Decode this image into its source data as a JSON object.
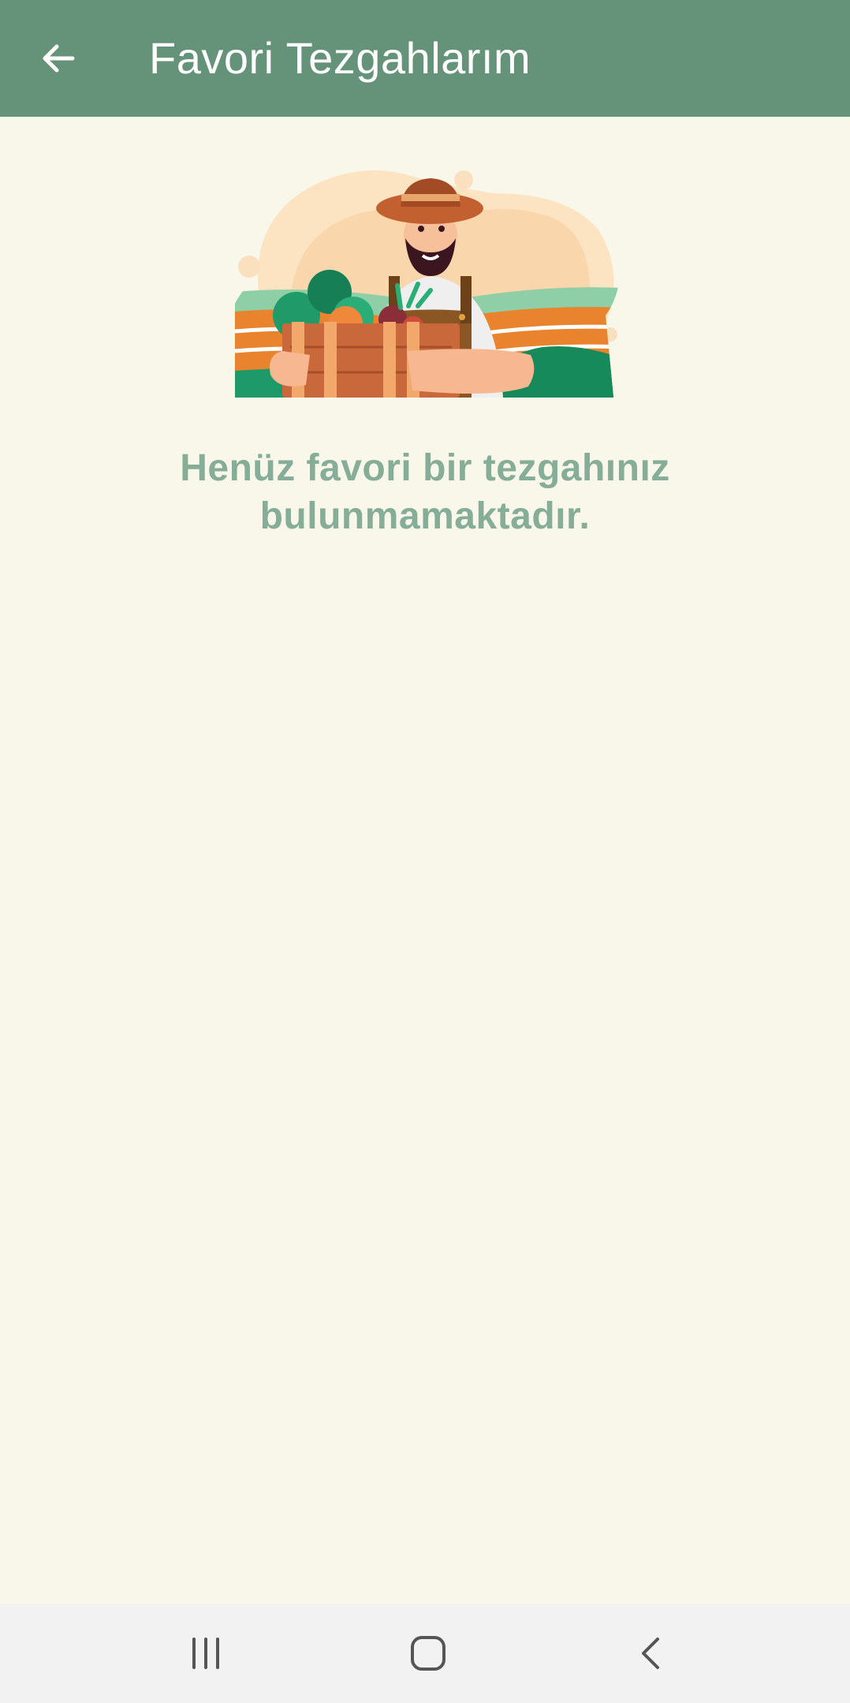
{
  "app_bar": {
    "title": "Favori Tezgahlarım",
    "back_icon": "arrow-left-icon",
    "background_color": "#65937A",
    "text_color": "#FFFFFF"
  },
  "content": {
    "background_color": "#F9F6EA",
    "illustration": "farmer-with-vegetable-crate-illustration",
    "empty_message": "Henüz favori bir tezgahınız bulunmamaktadır.",
    "message_color": "#86AD98"
  },
  "system_nav": {
    "recent_apps_icon": "recent-apps-icon",
    "home_icon": "home-icon",
    "back_icon": "back-chevron-icon",
    "background_color": "#F2F2F2"
  }
}
